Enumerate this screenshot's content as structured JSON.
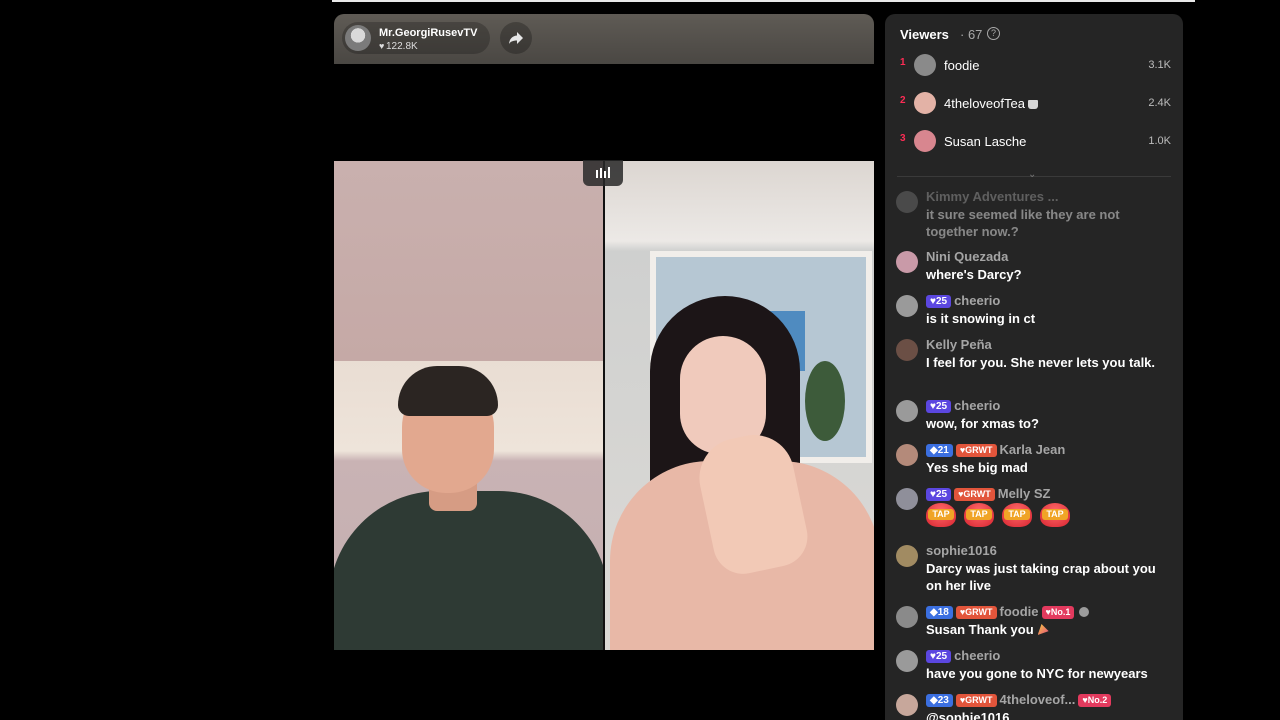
{
  "stream": {
    "host_name": "Mr.GeorgiRusevTV",
    "host_likes": "122.8K"
  },
  "viewers": {
    "title": "Viewers",
    "count": "· 67",
    "ranking": [
      {
        "rank": "1",
        "name": "foodie",
        "score": "3.1K",
        "avatar_color": "#8a8a8a"
      },
      {
        "rank": "2",
        "name": "4theloveofTea",
        "score": "2.4K",
        "avatar_color": "#e3b2a6"
      },
      {
        "rank": "3",
        "name": "Susan Lasche",
        "score": "1.0K",
        "avatar_color": "#d8868f"
      }
    ]
  },
  "chat": {
    "messages": [
      {
        "user": "Kimmy Adventures ...",
        "text": "it sure seemed like they are not together now.?"
      },
      {
        "user": "Nini Quezada",
        "text": "where's Darcy?"
      },
      {
        "level": "25",
        "user": "cheerio",
        "text": "is it snowing in ct"
      },
      {
        "user": "Kelly Peña",
        "text": "I feel for you. She never lets you talk."
      },
      {
        "level": "25",
        "user": "cheerio",
        "text": "wow, for xmas to?"
      },
      {
        "level": "21",
        "fan": "GRWT",
        "user": "Karla Jean",
        "text": "Yes she big mad"
      },
      {
        "level": "25",
        "fan": "GRWT",
        "user": "Melly SZ",
        "taps": [
          "TAP",
          "TAP",
          "TAP",
          "TAP"
        ]
      },
      {
        "user": "sophie1016",
        "text": "Darcy was just taking crap about you on her live"
      },
      {
        "level": "18",
        "fan": "GRWT",
        "user": "foodie",
        "badge": "No.1",
        "text": "Susan Thank you"
      },
      {
        "level": "25",
        "user": "cheerio",
        "text": "have you gone to NYC for newyears"
      },
      {
        "level": "23",
        "fan": "GRWT",
        "user": "4theloveof...",
        "badge": "No.2",
        "text": "@sophie1016"
      }
    ]
  },
  "colors": {
    "accent": "#fe2c55",
    "panel_bg": "#252525",
    "level_badge": "#5b47e0",
    "fan_badge": "#e2553b"
  },
  "icons": [
    "share-icon",
    "audio-bars-icon",
    "help-icon",
    "heart-icon",
    "chevron-down-icon"
  ]
}
